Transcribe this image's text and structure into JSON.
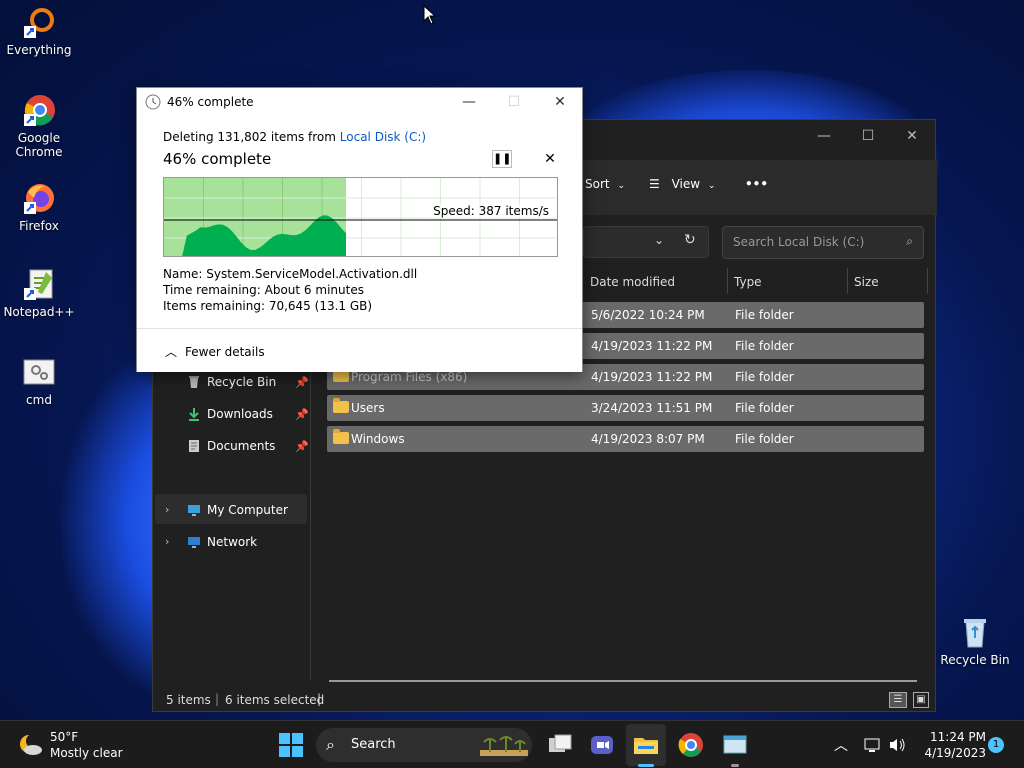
{
  "desktop": {
    "icons": [
      {
        "label": "Everything"
      },
      {
        "label": "Google\nChrome"
      },
      {
        "label": "Firefox"
      },
      {
        "label": "Notepad++"
      },
      {
        "label": "cmd"
      },
      {
        "label": "Recycle Bin"
      }
    ]
  },
  "explorer": {
    "toolbar": {
      "sort": "Sort",
      "view": "View",
      "more": "•••"
    },
    "search_placeholder": "Search Local Disk (C:)",
    "columns": [
      "Date modified",
      "Type",
      "Size"
    ],
    "rows": [
      {
        "name": "",
        "date": "5/6/2022 10:24 PM",
        "type": "File folder"
      },
      {
        "name": "",
        "date": "4/19/2023 11:22 PM",
        "type": "File folder"
      },
      {
        "name": "Program Files (x86)",
        "date": "4/19/2023 11:22 PM",
        "type": "File folder"
      },
      {
        "name": "Users",
        "date": "3/24/2023 11:51 PM",
        "type": "File folder"
      },
      {
        "name": "Windows",
        "date": "4/19/2023 8:07 PM",
        "type": "File folder"
      }
    ],
    "nav": {
      "recycle": "Recycle Bin",
      "downloads": "Downloads",
      "documents": "Documents",
      "mycomputer": "My Computer",
      "network": "Network"
    },
    "status": {
      "items": "5 items",
      "selected": "6 items selected"
    }
  },
  "dialog": {
    "title": "46% complete",
    "deleting_prefix": "Deleting 131,802 items from ",
    "deleting_target": "Local Disk (C:)",
    "heading": "46% complete",
    "progress": 0.46,
    "speed": "Speed: 387 items/s",
    "name_line": "Name:  System.ServiceModel.Activation.dll",
    "time_line": "Time remaining:  About 6 minutes",
    "items_line": "Items remaining:  70,645 (13.1 GB)",
    "fewer": "Fewer details"
  },
  "taskbar": {
    "weather_temp": "50°F",
    "weather_desc": "Mostly clear",
    "search": "Search",
    "time": "11:24 PM",
    "date": "4/19/2023",
    "notif": "1"
  },
  "colors": {
    "accent": "#0a5bc4",
    "graph_fill": "#00b050",
    "graph_done": "#a8e29a"
  }
}
